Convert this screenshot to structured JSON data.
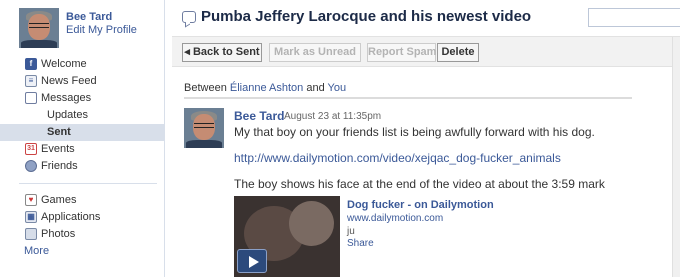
{
  "profile": {
    "name": "Bee Tard",
    "edit_label": "Edit My Profile"
  },
  "sidebar": {
    "items": [
      {
        "label": "Welcome",
        "icon": "facebook-icon"
      },
      {
        "label": "News Feed",
        "icon": "news-feed-icon"
      },
      {
        "label": "Messages",
        "icon": "messages-icon"
      },
      {
        "label": "Updates",
        "icon": ""
      },
      {
        "label": "Sent",
        "icon": "",
        "selected": true
      },
      {
        "label": "Events",
        "icon": "calendar-icon"
      },
      {
        "label": "Friends",
        "icon": "friends-icon"
      }
    ],
    "apps": [
      {
        "label": "Games",
        "icon": "games-icon"
      },
      {
        "label": "Applications",
        "icon": "applications-icon"
      },
      {
        "label": "Photos",
        "icon": "photos-icon"
      }
    ],
    "more_label": "More",
    "calendar_glyph": "31"
  },
  "header": {
    "title": "Pumba Jeffery Larocque and his newest video",
    "search_value": ""
  },
  "toolbar": {
    "back_label": "◂ Back to Sent",
    "mark_unread_label": "Mark as Unread",
    "report_spam_label": "Report Spam",
    "delete_label": "Delete"
  },
  "thread": {
    "between_prefix": "Between",
    "participant_1": "Élianne Ashton",
    "and_word": "and",
    "participant_2": "You"
  },
  "message": {
    "sender": "Bee Tard",
    "timestamp": "August 23 at 11:35pm",
    "line1": "My that boy on your friends list is being awfully forward with his dog.",
    "link": "http://www.dailymotion.com/video/xejqac_dog-fucker_animals",
    "line3": "The boy shows his face at the end of the video at about the 3:59 mark"
  },
  "attachment": {
    "title": "Dog fucker - on Dailymotion",
    "domain": "www.dailymotion.com",
    "description": "ju",
    "share_label": "Share"
  },
  "colors": {
    "link": "#3b5998",
    "selected_bg": "#d8dfea",
    "toolbar_bg": "#f2f2f2"
  }
}
